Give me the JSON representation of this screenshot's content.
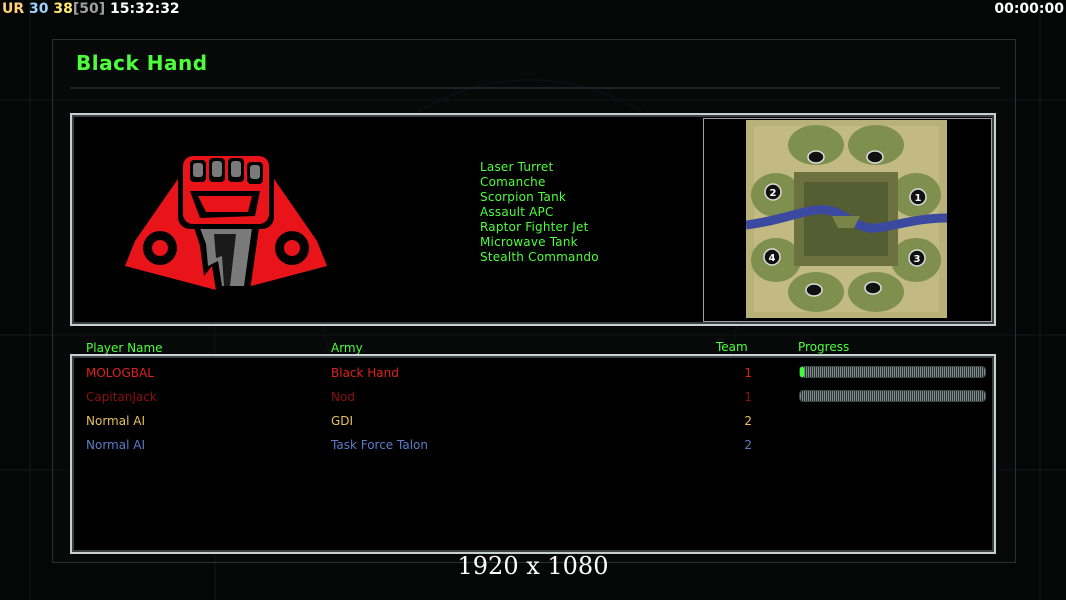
{
  "overlay": {
    "left_prefix": "UR",
    "fps1": "30",
    "fps2": "38",
    "fps_cap": "[50]",
    "clock": "15:32:32",
    "timer": "00:00:00"
  },
  "title": "Black Hand",
  "faction_logo_icon": "black-hand-fist-logo",
  "units": [
    "Laser Turret",
    "Comanche",
    "Scorpion Tank",
    "Assault APC",
    "Raptor Fighter Jet",
    "Microwave Tank",
    "Stealth Commando"
  ],
  "map": {
    "start_positions": [
      "1",
      "2",
      "3",
      "4"
    ]
  },
  "table": {
    "headers": {
      "player": "Player Name",
      "army": "Army",
      "team": "Team",
      "progress": "Progress"
    },
    "rows": [
      {
        "player": "MOLOGBAL",
        "army": "Black Hand",
        "team": "1",
        "color": "#e02020",
        "progress": 0.02
      },
      {
        "player": "CapitanJack",
        "army": "Nod",
        "team": "1",
        "color": "#8c1010",
        "progress": 0.0
      },
      {
        "player": "Normal AI",
        "army": "GDI",
        "team": "2",
        "color": "#e8c15a",
        "progress": null
      },
      {
        "player": "Normal AI",
        "army": "Task Force Talon",
        "team": "2",
        "color": "#5c7cc8",
        "progress": null
      }
    ]
  },
  "resolution_label": "1920 x 1080",
  "colors": {
    "accent_green": "#4dff3a",
    "frame": "#c9cfcf"
  }
}
